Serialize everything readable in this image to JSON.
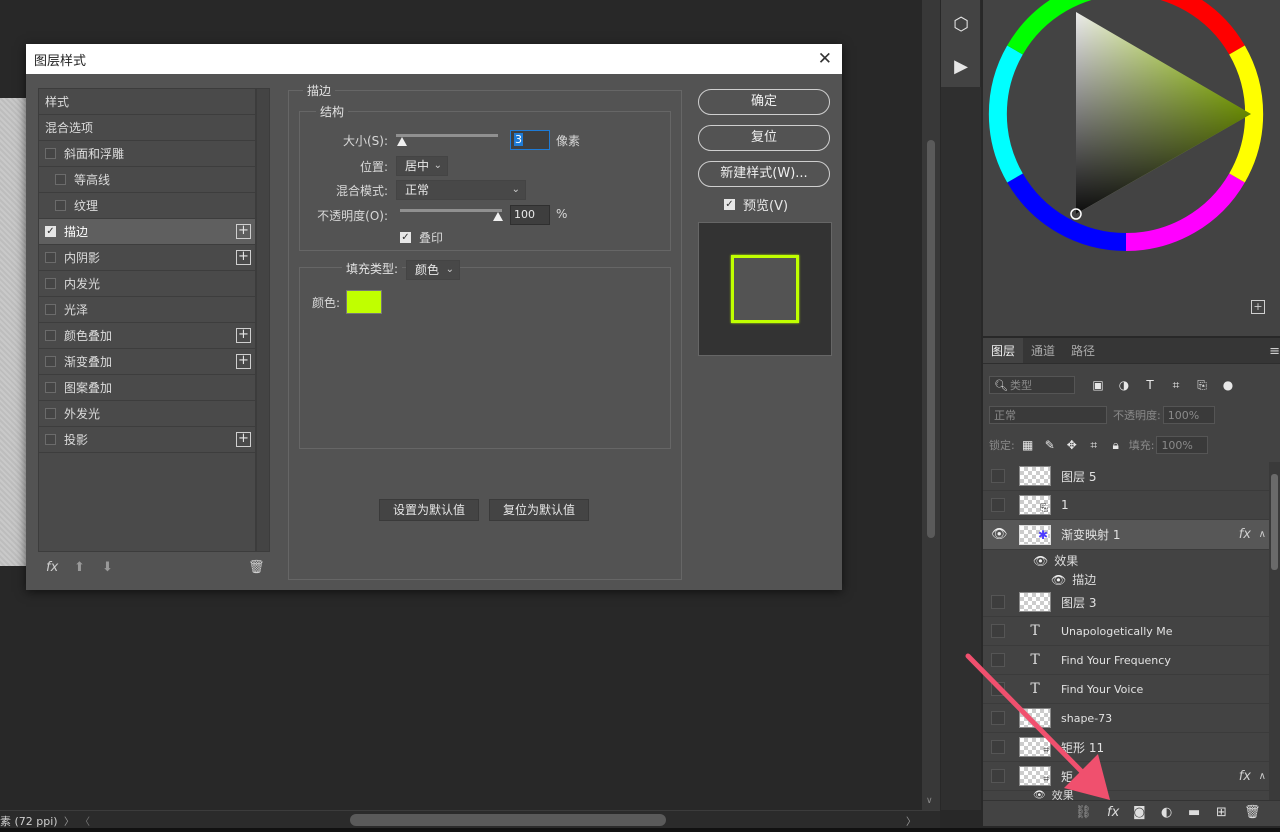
{
  "dialog": {
    "title": "图层样式",
    "styles_header": "样式",
    "blend_options": "混合选项",
    "items": [
      {
        "label": "斜面和浮雕",
        "checked": false,
        "indent": false,
        "plus": false
      },
      {
        "label": "等高线",
        "checked": false,
        "indent": true,
        "plus": false
      },
      {
        "label": "纹理",
        "checked": false,
        "indent": true,
        "plus": false
      },
      {
        "label": "描边",
        "checked": true,
        "indent": false,
        "plus": true,
        "selected": true
      },
      {
        "label": "内阴影",
        "checked": false,
        "indent": false,
        "plus": true
      },
      {
        "label": "内发光",
        "checked": false,
        "indent": false,
        "plus": false
      },
      {
        "label": "光泽",
        "checked": false,
        "indent": false,
        "plus": false
      },
      {
        "label": "颜色叠加",
        "checked": false,
        "indent": false,
        "plus": true
      },
      {
        "label": "渐变叠加",
        "checked": false,
        "indent": false,
        "plus": true
      },
      {
        "label": "图案叠加",
        "checked": false,
        "indent": false,
        "plus": false
      },
      {
        "label": "外发光",
        "checked": false,
        "indent": false,
        "plus": false
      },
      {
        "label": "投影",
        "checked": false,
        "indent": false,
        "plus": true
      }
    ],
    "stroke": {
      "group_label": "描边",
      "structure_label": "结构",
      "size_label": "大小(S):",
      "size_value": "3",
      "size_unit": "像素",
      "position_label": "位置:",
      "position_value": "居中",
      "blend_label": "混合模式:",
      "blend_value": "正常",
      "opacity_label": "不透明度(O):",
      "opacity_value": "100",
      "opacity_unit": "%",
      "overprint_label": "叠印",
      "fill_type_label": "填充类型:",
      "fill_type_value": "颜色",
      "color_label": "颜色:",
      "color_value": "#c0ff00",
      "set_default": "设置为默认值",
      "reset_default": "复位为默认值"
    },
    "buttons": {
      "ok": "确定",
      "reset": "复位",
      "new_style": "新建样式(W)...",
      "preview": "预览(V)"
    }
  },
  "layers_panel": {
    "tabs": [
      "图层",
      "通道",
      "路径"
    ],
    "filter_placeholder": "类型",
    "blend_mode": "正常",
    "opacity_label": "不透明度:",
    "opacity_value": "100%",
    "lock_label": "锁定:",
    "fill_label": "填充:",
    "fill_value": "100%",
    "layers": [
      {
        "name": "图层 5",
        "type": "pixel"
      },
      {
        "name": "1",
        "type": "smart"
      },
      {
        "name": "渐变映射 1",
        "type": "pixel",
        "visible": true,
        "active": true,
        "fx": true
      },
      {
        "name": "效果",
        "type": "effects"
      },
      {
        "name": "描边",
        "type": "effect"
      },
      {
        "name": "图层 3",
        "type": "pixel"
      },
      {
        "name": "Unapologetically  Me",
        "type": "text"
      },
      {
        "name": "Find Your Frequency",
        "type": "text"
      },
      {
        "name": "Find Your Voice",
        "type": "text"
      },
      {
        "name": "shape-73",
        "type": "pixel"
      },
      {
        "name": "矩形 11",
        "type": "shape"
      },
      {
        "name": "矩",
        "type": "shape",
        "fx": true
      },
      {
        "name": "效果",
        "type": "effects"
      }
    ],
    "fx_glyph": "fx"
  },
  "status_bar": {
    "text": "素 (72 ppi)"
  },
  "colors": {
    "stroke_color": "#c0ff00",
    "accent_blue": "#1e7bd6",
    "arrow_red": "#f0506e"
  }
}
